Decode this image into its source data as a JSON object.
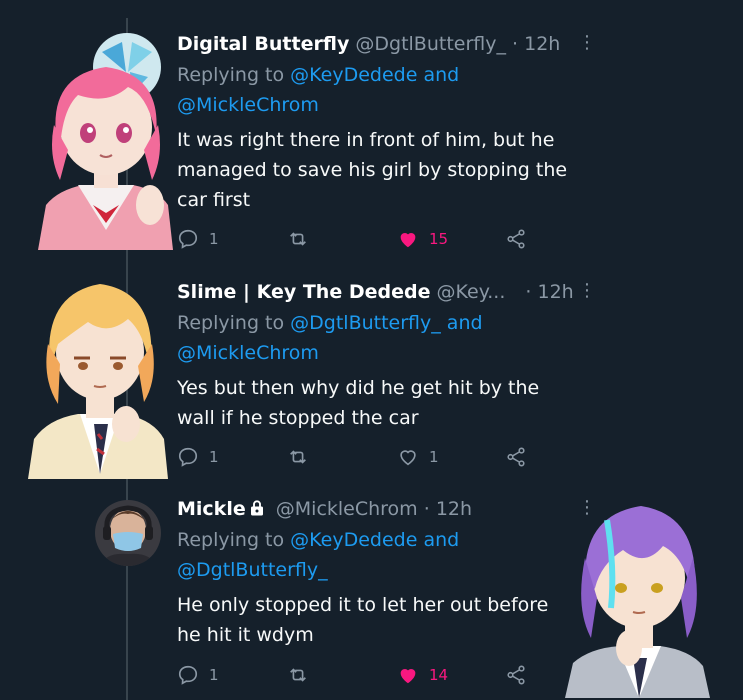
{
  "tweets": [
    {
      "name": "Digital Butterfly",
      "handle": "@DgtlButterfly_",
      "time": "· 12h",
      "replying_prefix": "Replying to ",
      "mention1": "@KeyDedede",
      "and": " and",
      "mention2": "@MickleChrom",
      "text_line1": "It was right there in front of him, but he",
      "text_line2": "managed to save his girl by stopping the",
      "text_line3": "car first",
      "reply_count": "1",
      "retweet_count": "",
      "like_count": "15",
      "liked": true
    },
    {
      "name": "Slime | Key The Dedede",
      "handle": "@Key...",
      "time": "· 12h",
      "replying_prefix": "Replying to ",
      "mention1": "@DgtlButterfly_",
      "and": " and",
      "mention2": "@MickleChrom",
      "text_line1": "Yes but then why did he get hit by the",
      "text_line2": "wall if he stopped the car",
      "reply_count": "1",
      "retweet_count": "",
      "like_count": "1",
      "liked": false
    },
    {
      "name": "Mickle",
      "handle": "@MickleChrom",
      "time": "· 12h",
      "replying_prefix": "Replying to ",
      "mention1": "@KeyDedede",
      "and": " and",
      "mention2": "@DgtlButterfly_",
      "text_line1": "He only stopped it to let her out before",
      "text_line2": "he hit it wdym",
      "reply_count": "1",
      "retweet_count": "",
      "like_count": "14",
      "liked": true
    }
  ],
  "icons": {
    "reply": "reply-icon",
    "retweet": "retweet-icon",
    "like": "heart-icon",
    "share": "share-icon",
    "more": "more-icon",
    "lock": "lock-icon"
  },
  "colors": {
    "background": "#15202b",
    "link": "#1d9bf0",
    "muted": "#8b98a5",
    "like": "#f91880"
  }
}
